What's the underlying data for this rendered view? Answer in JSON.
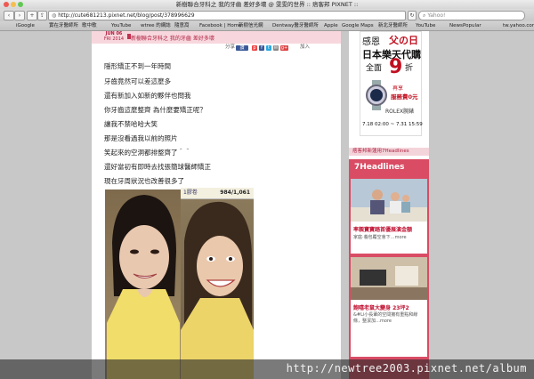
{
  "window": {
    "title": "新樹聯合牙科之 我的牙齒 差好多壞 @ 雯雯的世界 :: 痞客邦 PIXNET ::"
  },
  "toolbar": {
    "url": "http://cute681213.pixnet.net/blog/post/378996629",
    "search_placeholder": "Yahoo!"
  },
  "bookmarks": [
    "iGoogle",
    "實在牙醫師所",
    "歌中歌",
    "YouTube",
    "wtree 的網誌",
    "隨意窩",
    "Facebook | Home",
    "新樹信光網",
    "Dentway醫牙醫師所",
    "Apple",
    "Google Maps",
    "新北牙醫師所",
    "YouTube",
    "News",
    "Popular",
    "tw.yahoo.com"
  ],
  "post": {
    "date_month": "JUN 06",
    "date_year": "FRI 2014",
    "title": "新樹聯合牙科之 我的牙齒 差好多壞",
    "share_label": "分享",
    "share_like": "讚",
    "share_join": "加入",
    "paragraphs": [
      "隱形矯正不到一年時間",
      "牙齒竟然可以差這麼多",
      "還有新加入如新的夥伴也問我",
      "你牙齒這麼整齊 為什麼要矯正呢？",
      "讓我不禁哈哈大笑",
      "那是沒看過我以前的照片",
      "笑起來的空洞都排整齊了＾＾",
      "還好當初有即時去找張簡球醫師矯正",
      "現在牙周狀況也改善很多了"
    ],
    "photo_caption_left": "1膠卷",
    "photo_counter": "984/1,061"
  },
  "sidebar": {
    "ad": {
      "store_line": "感恩",
      "holiday": "父の日",
      "store_name": "日本樂天代購",
      "discount_prefix": "全面",
      "discount_num": "9",
      "discount_suffix": "折",
      "promo1": "再享",
      "promo2": "服務費0元",
      "brand": "ROLEX腕錶",
      "date_range": "7.18 02:00 ~ 7.31 15:59"
    },
    "section_title": "痞客邦新蓮用7Headlines",
    "headlines_logo": "7Headlines",
    "items": [
      {
        "title": "率親寶寶踏首優展演金額",
        "desc": "家庭·養包覆空會下…more"
      },
      {
        "title": "飽嘻老鼠大變身 23坪2",
        "desc": "&#Li小長輩的空間擁有重點和線條，整潔加…more"
      }
    ]
  },
  "watermark": "http://newtree2003.pixnet.net/album",
  "colors": {
    "accent": "#b02040",
    "header_pink": "#f7d7dd"
  }
}
